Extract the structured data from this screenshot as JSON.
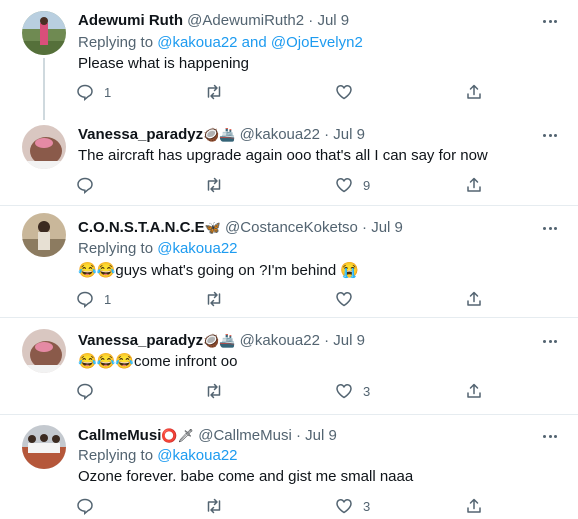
{
  "tweets": [
    {
      "name": "Adewumi Ruth",
      "name_emoji": "",
      "handle": "@AdewumiRuth2",
      "sep": "·",
      "date": "Jul 9",
      "replying_prefix": "Replying to",
      "replying_to": "@kakoua22 and @OjoEvelyn2",
      "text": "Please what is happening",
      "reply_count": "1",
      "retweet_count": "",
      "like_count": ""
    },
    {
      "name": "Vanessa_paradyz",
      "name_emoji": "🥥🚢",
      "handle": "@kakoua22",
      "sep": "·",
      "date": "Jul 9",
      "text": "The aircraft has upgrade again ooo that's all I can say for now",
      "reply_count": "",
      "retweet_count": "",
      "like_count": "9"
    },
    {
      "name": "C.O.N.S.T.A.N.C.E",
      "name_emoji": "🦋",
      "handle": "@CostanceKoketso",
      "sep": "·",
      "date": "Jul 9",
      "replying_prefix": "Replying to",
      "replying_to": "@kakoua22",
      "text": "😂😂guys what's going on ?I'm behind 😭",
      "reply_count": "1",
      "retweet_count": "",
      "like_count": ""
    },
    {
      "name": "Vanessa_paradyz",
      "name_emoji": "🥥🚢",
      "handle": "@kakoua22",
      "sep": "·",
      "date": "Jul 9",
      "text": "😂😂😂come infront oo",
      "reply_count": "",
      "retweet_count": "",
      "like_count": "3"
    },
    {
      "name": "CallmeMusi",
      "name_emoji": "⭕🗡",
      "handle": "@CallmeMusi",
      "sep": "·",
      "date": "Jul 9",
      "replying_prefix": "Replying to",
      "replying_to": "@kakoua22",
      "text": "Ozone forever. babe come and gist me small naaa",
      "reply_count": "",
      "retweet_count": "",
      "like_count": "3"
    }
  ],
  "icons": {
    "reply": "speech-bubble-icon",
    "retweet": "retweet-arrows-icon",
    "like": "heart-icon",
    "share": "share-upload-icon",
    "more": "more-dots-icon"
  },
  "colors": {
    "text": "#0f1419",
    "secondary": "#536471",
    "link": "#1d9bf0",
    "divider": "#e6ecf0",
    "thread_line": "#cfd9de"
  }
}
